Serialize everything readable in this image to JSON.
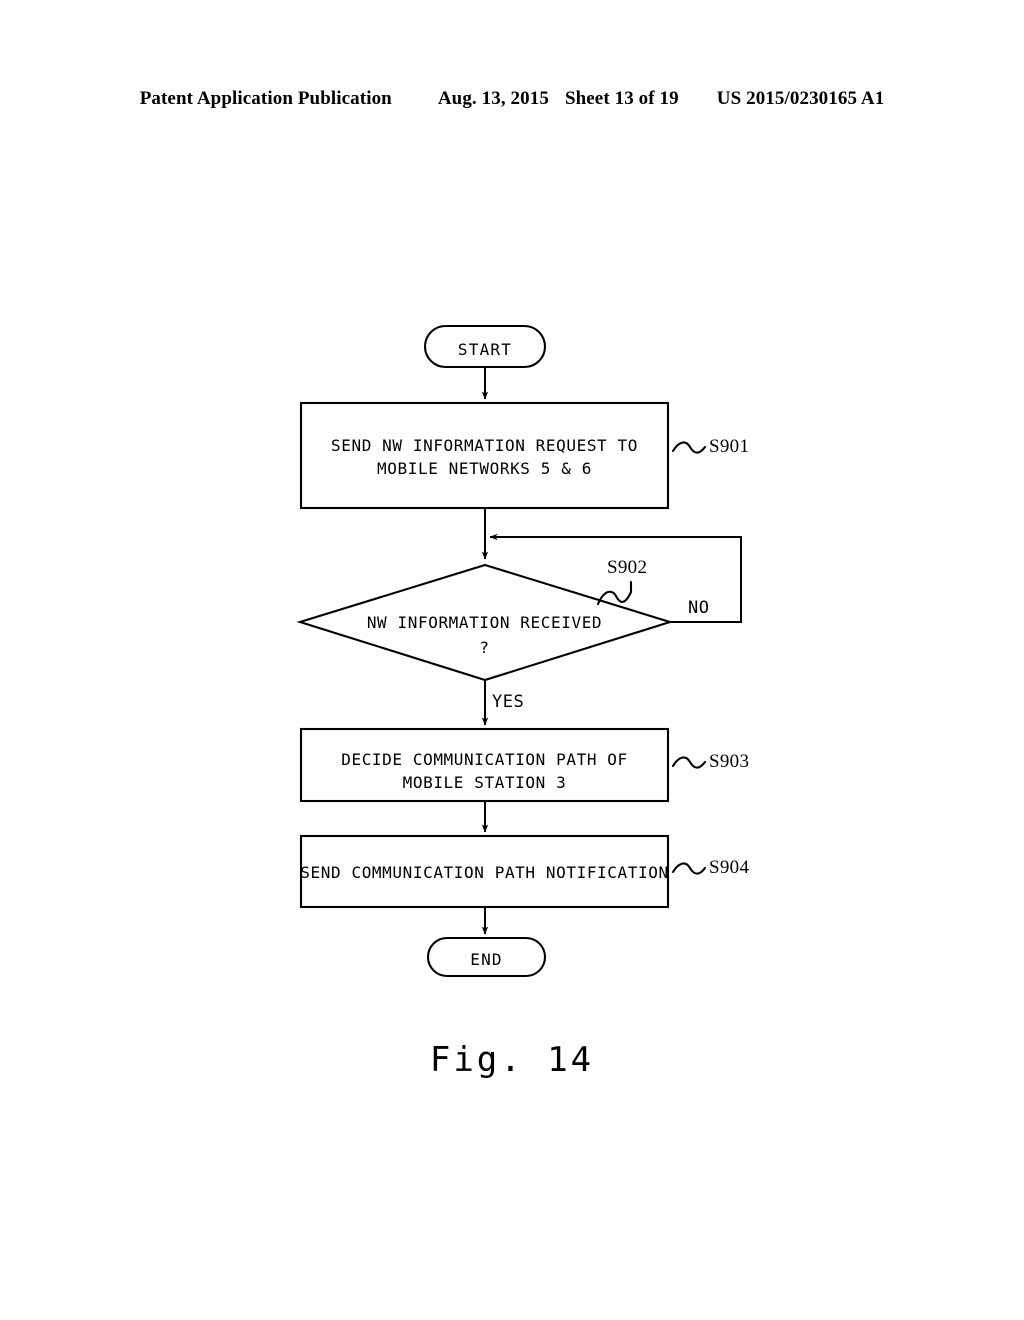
{
  "header": {
    "publication": "Patent Application Publication",
    "date": "Aug. 13, 2015",
    "sheet": "Sheet 13 of 19",
    "patent_number": "US 2015/0230165 A1"
  },
  "figure": {
    "caption": "Fig.  14",
    "type": "flowchart"
  },
  "flowchart": {
    "nodes": [
      {
        "id": "start",
        "shape": "terminal",
        "label": "START",
        "ref": ""
      },
      {
        "id": "s901",
        "shape": "process",
        "line1": "SEND NW INFORMATION REQUEST TO",
        "line2": "MOBILE NETWORKS 5 & 6",
        "ref": "S901"
      },
      {
        "id": "s902",
        "shape": "decision",
        "line1": "NW INFORMATION RECEIVED",
        "line2": "?",
        "ref": "S902"
      },
      {
        "id": "s903",
        "shape": "process",
        "line1": "DECIDE COMMUNICATION PATH OF",
        "line2": "MOBILE STATION 3",
        "ref": "S903"
      },
      {
        "id": "s904",
        "shape": "process",
        "line1": "SEND COMMUNICATION PATH NOTIFICATION",
        "line2": "",
        "ref": "S904"
      },
      {
        "id": "end",
        "shape": "terminal",
        "label": "END",
        "ref": ""
      }
    ],
    "branches": {
      "yes": "YES",
      "no": "NO"
    }
  },
  "colors": {
    "ink": "#000000",
    "paper": "#ffffff"
  }
}
